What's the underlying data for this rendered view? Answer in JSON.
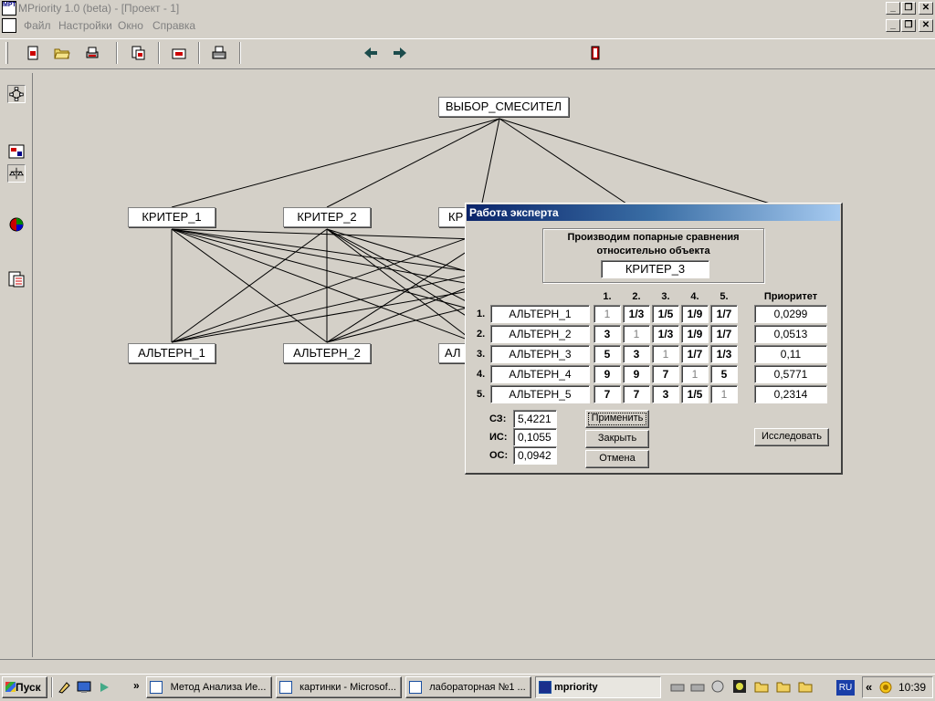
{
  "window": {
    "title": "MPriority 1.0 (beta) - [Проект - 1]",
    "app_icon_text": "МРТ"
  },
  "menu": [
    "Файл",
    "Настройки",
    "Окно",
    "Справка"
  ],
  "canvas": {
    "root": "ВЫБОР_СМЕСИТЕЛ",
    "criteria": [
      "КРИТЕР_1",
      "КРИТЕР_2",
      "КР"
    ],
    "alternatives": [
      "АЛЬТЕРН_1",
      "АЛЬТЕРН_2",
      "АЛ"
    ]
  },
  "dialog": {
    "title": "Работа эксперта",
    "heading_line1": "Производим попарные сравнения",
    "heading_line2": "относительно объекта",
    "object": "КРИТЕР_3",
    "col_headers": [
      "1.",
      "2.",
      "3.",
      "4.",
      "5."
    ],
    "priority_header": "Приоритет",
    "rows": [
      {
        "num": "1.",
        "name": "АЛЬТЕРН_1",
        "values": [
          "1",
          "1/3",
          "1/5",
          "1/9",
          "1/7"
        ],
        "priority": "0,0299"
      },
      {
        "num": "2.",
        "name": "АЛЬТЕРН_2",
        "values": [
          "3",
          "1",
          "1/3",
          "1/9",
          "1/7"
        ],
        "priority": "0,0513"
      },
      {
        "num": "3.",
        "name": "АЛЬТЕРН_3",
        "values": [
          "5",
          "3",
          "1",
          "1/7",
          "1/3"
        ],
        "priority": "0,11"
      },
      {
        "num": "4.",
        "name": "АЛЬТЕРН_4",
        "values": [
          "9",
          "9",
          "7",
          "1",
          "5"
        ],
        "priority": "0,5771"
      },
      {
        "num": "5.",
        "name": "АЛЬТЕРН_5",
        "values": [
          "7",
          "7",
          "3",
          "1/5",
          "1"
        ],
        "priority": "0,2314"
      }
    ],
    "stats": [
      {
        "label": "СЗ:",
        "value": "5,4221"
      },
      {
        "label": "ИС:",
        "value": "0,1055"
      },
      {
        "label": "ОС:",
        "value": "0,0942"
      }
    ],
    "buttons": {
      "apply": "Применить",
      "close": "Закрыть",
      "cancel": "Отмена",
      "explore": "Исследовать"
    }
  },
  "taskbar": {
    "start": "Пуск",
    "tasks": [
      "Метод Анализа Ие...",
      "картинки - Microsof...",
      "лабораторная №1 ...",
      "mpriority"
    ],
    "lang": "RU",
    "time": "10:39"
  },
  "colors": {
    "titlebar_active": "#0a246a",
    "face": "#d4d0c8"
  }
}
